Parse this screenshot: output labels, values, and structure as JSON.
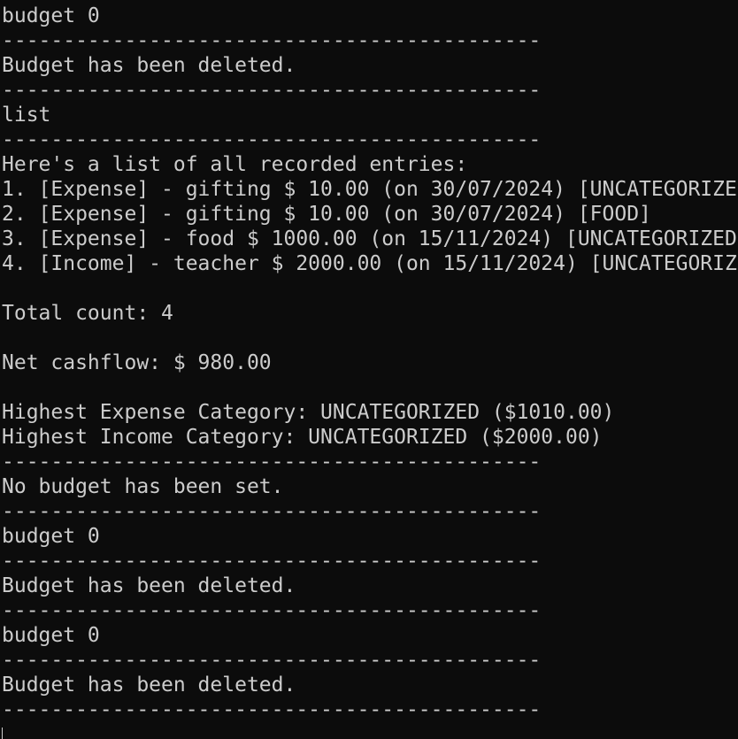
{
  "terminal": {
    "lines": [
      "budget 0",
      "--------------------------------------------",
      "Budget has been deleted.",
      "--------------------------------------------",
      "list",
      "--------------------------------------------",
      "Here's a list of all recorded entries:",
      "1. [Expense] - gifting $ 10.00 (on 30/07/2024) [UNCATEGORIZE",
      "2. [Expense] - gifting $ 10.00 (on 30/07/2024) [FOOD]",
      "3. [Expense] - food $ 1000.00 (on 15/11/2024) [UNCATEGORIZED",
      "4. [Income] - teacher $ 2000.00 (on 15/11/2024) [UNCATEGORIZ",
      "",
      "Total count: 4",
      "",
      "Net cashflow: $ 980.00",
      "",
      "Highest Expense Category: UNCATEGORIZED ($1010.00)",
      "Highest Income Category: UNCATEGORIZED ($2000.00)",
      "--------------------------------------------",
      "No budget has been set.",
      "--------------------------------------------",
      "budget 0",
      "--------------------------------------------",
      "Budget has been deleted.",
      "--------------------------------------------",
      "budget 0",
      "--------------------------------------------",
      "Budget has been deleted.",
      "--------------------------------------------"
    ]
  },
  "colors": {
    "background": "#0c0c0c",
    "text": "#cccccc"
  }
}
